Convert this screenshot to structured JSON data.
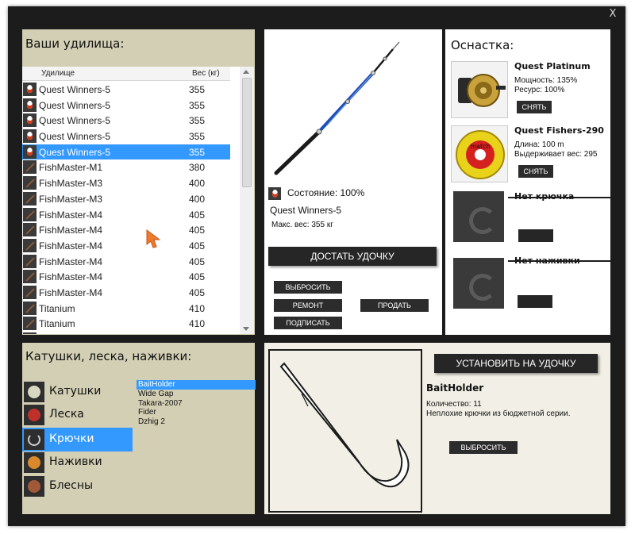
{
  "window": {
    "close_label": "X"
  },
  "rods": {
    "title": "Ваши удилища:",
    "columns": {
      "name": "Удилище",
      "weight": "Вес (кг)"
    },
    "rows": [
      {
        "name": "Quest Winners-5",
        "weight": "355",
        "icon": "quest-rod-icon",
        "selected": false
      },
      {
        "name": "Quest Winners-5",
        "weight": "355",
        "icon": "quest-rod-icon",
        "selected": false
      },
      {
        "name": "Quest Winners-5",
        "weight": "355",
        "icon": "quest-rod-icon",
        "selected": false
      },
      {
        "name": "Quest Winners-5",
        "weight": "355",
        "icon": "quest-rod-icon",
        "selected": false
      },
      {
        "name": "Quest Winners-5",
        "weight": "355",
        "icon": "quest-rod-icon",
        "selected": true
      },
      {
        "name": "FishMaster-M1",
        "weight": "380",
        "icon": "rod-icon",
        "selected": false
      },
      {
        "name": "FishMaster-M3",
        "weight": "400",
        "icon": "rod-icon",
        "selected": false
      },
      {
        "name": "FishMaster-M3",
        "weight": "400",
        "icon": "rod-icon",
        "selected": false
      },
      {
        "name": "FishMaster-M4",
        "weight": "405",
        "icon": "rod-icon",
        "selected": false
      },
      {
        "name": "FishMaster-M4",
        "weight": "405",
        "icon": "rod-icon",
        "selected": false
      },
      {
        "name": "FishMaster-M4",
        "weight": "405",
        "icon": "rod-icon",
        "selected": false
      },
      {
        "name": "FishMaster-M4",
        "weight": "405",
        "icon": "rod-icon",
        "selected": false
      },
      {
        "name": "FishMaster-M4",
        "weight": "405",
        "icon": "rod-icon",
        "selected": false
      },
      {
        "name": "FishMaster-M4",
        "weight": "405",
        "icon": "rod-icon",
        "selected": false
      },
      {
        "name": "Titanium",
        "weight": "410",
        "icon": "rod-icon",
        "selected": false
      },
      {
        "name": "Titanium",
        "weight": "410",
        "icon": "rod-icon",
        "selected": false
      },
      {
        "name": "Titanium",
        "weight": "410",
        "icon": "rod-icon",
        "selected": false
      }
    ]
  },
  "rod_detail": {
    "state_label": "Состояние: 100%",
    "name": "Quest Winners-5",
    "max_weight": "Макс. вес: 355 кг",
    "take_out_button": "ДОСТАТЬ УДОЧКУ",
    "throw_away_button": "ВЫБРОСИТЬ",
    "repair_button": "РЕМОНТ",
    "sell_button": "ПРОДАТЬ",
    "sign_button": "ПОДПИСАТЬ"
  },
  "tackle": {
    "title": "Оснастка:",
    "reel": {
      "name": "Quest Platinum",
      "stat1": "Мощность: 135%",
      "stat2": "Ресурс: 100%",
      "remove_button": "СНЯТЬ"
    },
    "line": {
      "name": "Quest Fishers-290",
      "stat1": "Длина: 100 m",
      "stat2": "Выдерживает вес: 295",
      "remove_button": "СНЯТЬ",
      "spool_text": "match"
    },
    "no_hook": "Нет крючка",
    "no_bait": "Нет наживки"
  },
  "items": {
    "title": "Катушки, леска, наживки:",
    "categories": [
      {
        "label": "Катушки",
        "selected": false
      },
      {
        "label": "Леска",
        "selected": false
      },
      {
        "label": "Крючки",
        "selected": true
      },
      {
        "label": "Наживки",
        "selected": false
      },
      {
        "label": "Блесны",
        "selected": false
      }
    ],
    "hooks": [
      {
        "label": "BaitHolder",
        "selected": true
      },
      {
        "label": "Wide Gap",
        "selected": false
      },
      {
        "label": "Takara-2007",
        "selected": false
      },
      {
        "label": "Fider",
        "selected": false
      },
      {
        "label": "Dzhig 2",
        "selected": false
      }
    ]
  },
  "hook_detail": {
    "install_button": "УСТАНОВИТЬ НА УДОЧКУ",
    "name": "BaitHolder",
    "quantity": "Количество: 11",
    "description": "Неплохие крючки из бюджетной серии.",
    "throw_away_button": "ВЫБРОСИТЬ"
  },
  "colors": {
    "selection": "#3399ff",
    "panel_beige": "#d3cfb4",
    "window_bg": "#1c1c1c",
    "button_dark": "#262626",
    "cursor_orange": "#f07a2a"
  }
}
